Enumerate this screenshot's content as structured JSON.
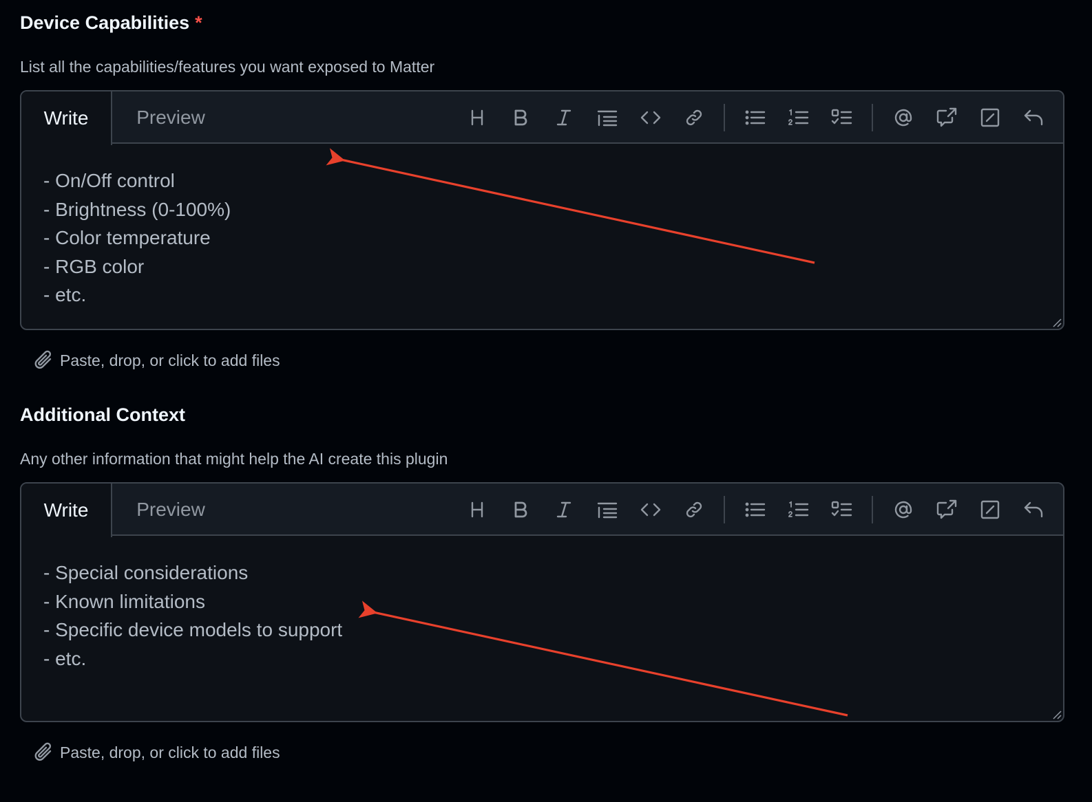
{
  "sections": [
    {
      "label": "Device Capabilities",
      "required_marker": "*",
      "description": "List all the capabilities/features you want exposed to Matter",
      "tabs": {
        "write": "Write",
        "preview": "Preview",
        "active": "write"
      },
      "placeholder": "- On/Off control\n- Brightness (0-100%)\n- Color temperature\n- RGB color\n- etc.",
      "value": "",
      "attach_text": "Paste, drop, or click to add files"
    },
    {
      "label": "Additional Context",
      "required_marker": "",
      "description": "Any other information that might help the AI create this plugin",
      "tabs": {
        "write": "Write",
        "preview": "Preview",
        "active": "write"
      },
      "placeholder": "- Special considerations\n- Known limitations\n- Specific device models to support\n- etc.",
      "value": "",
      "attach_text": "Paste, drop, or click to add files"
    }
  ],
  "toolbar_tools": [
    "heading-icon",
    "bold-icon",
    "italic-icon",
    "quote-icon",
    "code-icon",
    "link-icon",
    "unordered-list-icon",
    "ordered-list-icon",
    "task-list-icon",
    "mention-icon",
    "cross-reference-icon",
    "saved-replies-icon",
    "undo-icon"
  ],
  "colors": {
    "page_bg": "#010409",
    "editor_bg": "#0d1117",
    "header_bg": "#151b23",
    "border": "#3d444d",
    "text_primary": "#f0f6fc",
    "text_muted": "#b4bcc6",
    "required": "#f85149",
    "annotation_arrow": "#e8412c"
  }
}
